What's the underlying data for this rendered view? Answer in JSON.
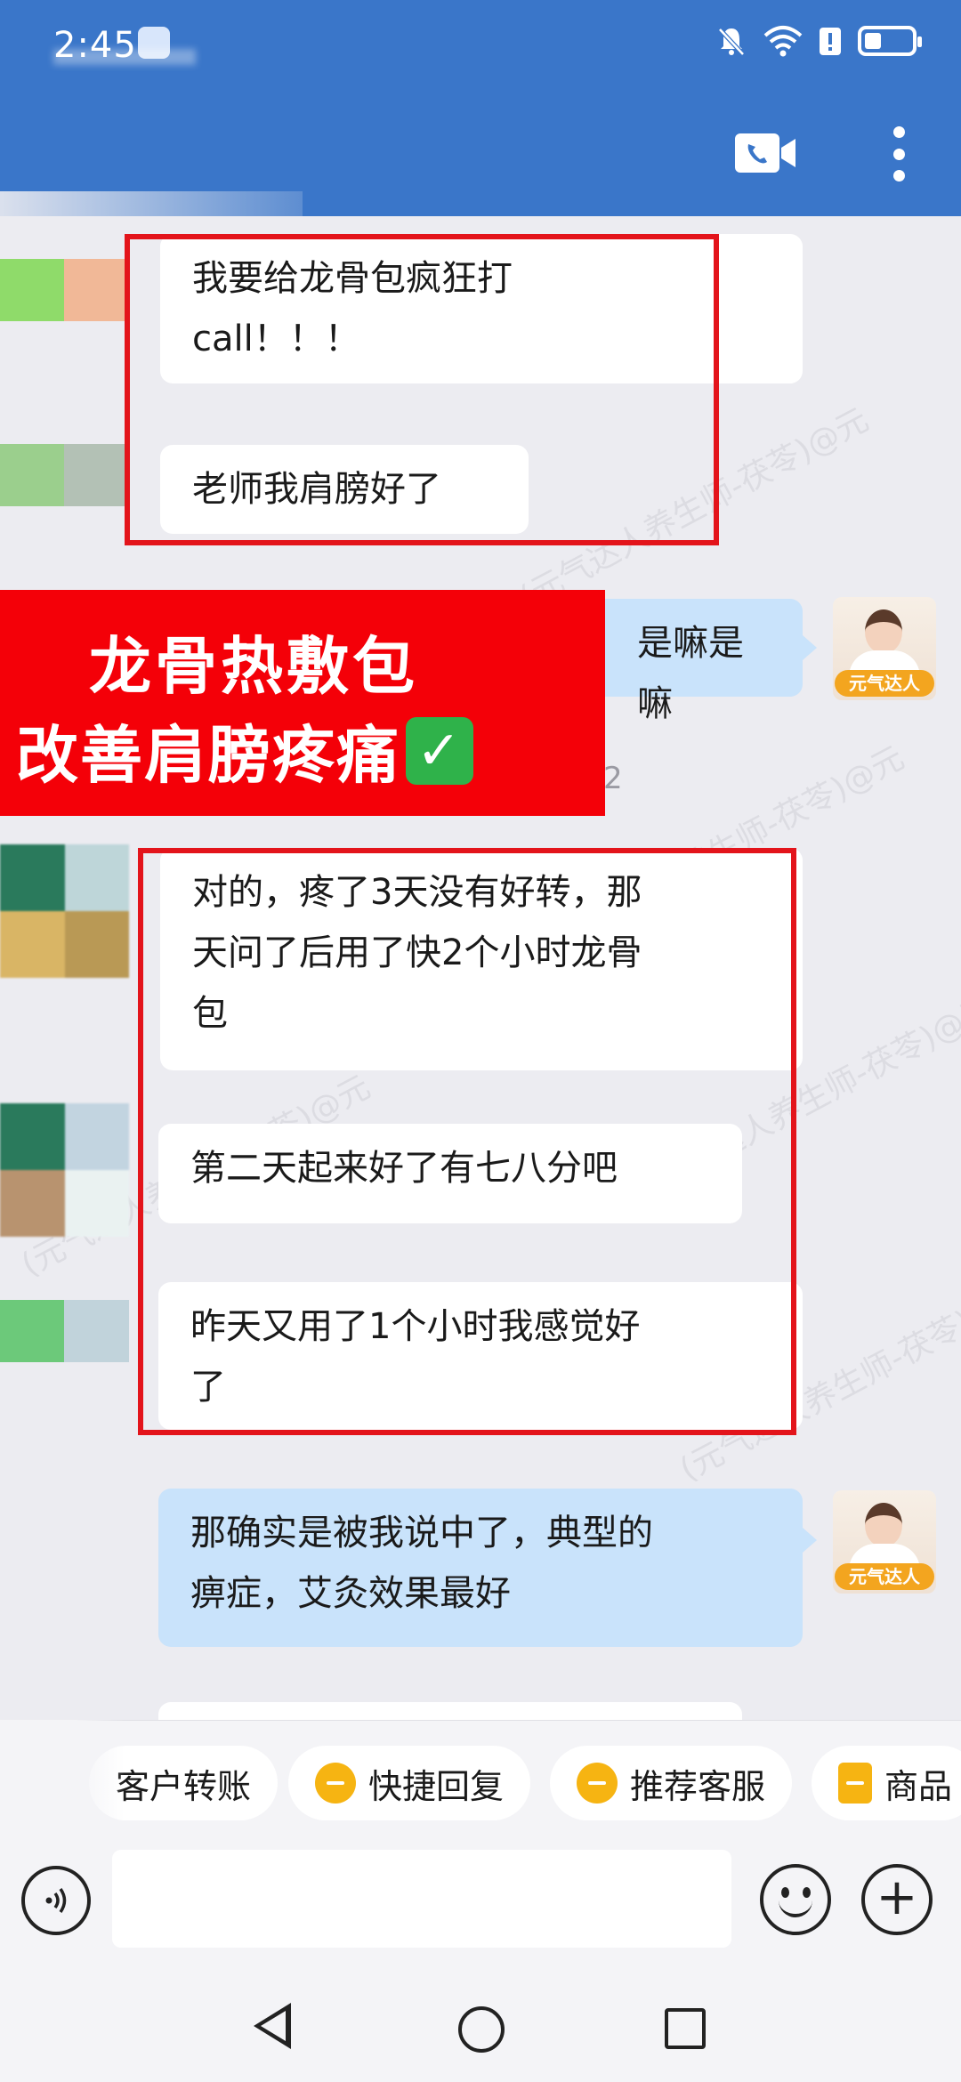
{
  "status": {
    "time": "2:45",
    "icons": [
      "mute-bell-icon",
      "wifi-icon",
      "alert-icon",
      "battery-icon"
    ]
  },
  "header": {
    "video_call_icon": "video-call-icon",
    "menu_icon": "more-vert-icon"
  },
  "messages": [
    {
      "side": "left",
      "text_lines": [
        "我要给龙骨包疯狂打",
        "call！！！"
      ]
    },
    {
      "side": "left",
      "text_lines": [
        "老师我肩膀好了"
      ]
    },
    {
      "side": "right",
      "text_lines": [
        "是嘛是嘛"
      ]
    },
    {
      "side": "left",
      "text_lines": [
        "对的，疼了3天没有好转，那",
        "天问了后用了快2个小时龙骨",
        "包"
      ]
    },
    {
      "side": "left",
      "text_lines": [
        "第二天起来好了有七八分吧"
      ]
    },
    {
      "side": "left",
      "text_lines": [
        "昨天又用了1个小时我感觉好",
        "了"
      ]
    },
    {
      "side": "right",
      "text_lines": [
        "那确实是被我说中了，典型的",
        "痹症，艾灸效果最好"
      ]
    }
  ],
  "time_fragment": "2",
  "promo": {
    "line1": "龙骨热敷包",
    "line2": "改善肩膀疼痛",
    "check": "✓"
  },
  "agent": {
    "tag": "元气达人"
  },
  "watermark": "(元气达人养生师-茯苓)@元",
  "chips": [
    {
      "label": "客户转账",
      "icon": ""
    },
    {
      "label": "快捷回复",
      "icon": "quick-reply-icon"
    },
    {
      "label": "推荐客服",
      "icon": "chat-bubble-icon"
    },
    {
      "label": "商品",
      "icon": "product-icon"
    }
  ],
  "input": {
    "placeholder": ""
  }
}
